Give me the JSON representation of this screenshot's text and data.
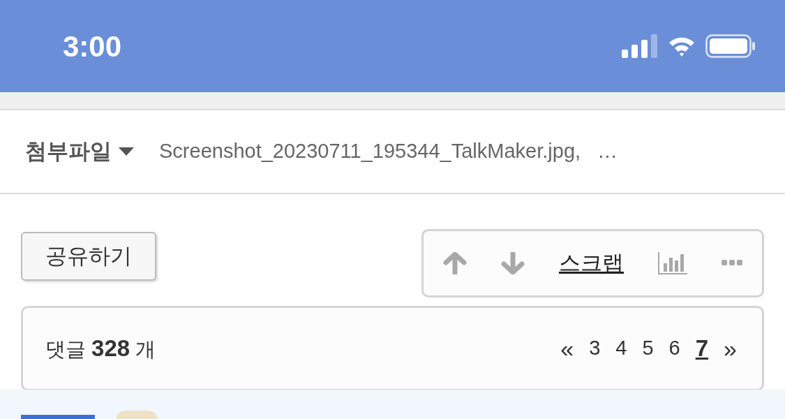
{
  "status_bar": {
    "time": "3:00"
  },
  "attachment": {
    "label": "첨부파일",
    "file": "Screenshot_20230711_195344_TalkMaker.jpg,",
    "more": "…"
  },
  "share_button": {
    "label": "공유하기"
  },
  "toolbar": {
    "scrap": "스크랩"
  },
  "comments": {
    "summary": "댓글 **328** 개",
    "prev": "«",
    "next": "»",
    "pages": [
      {
        "label": "3",
        "selected": false
      },
      {
        "label": "4",
        "selected": false
      },
      {
        "label": "5",
        "selected": false
      },
      {
        "label": "6",
        "selected": false
      },
      {
        "label": "7",
        "selected": true
      }
    ]
  }
}
